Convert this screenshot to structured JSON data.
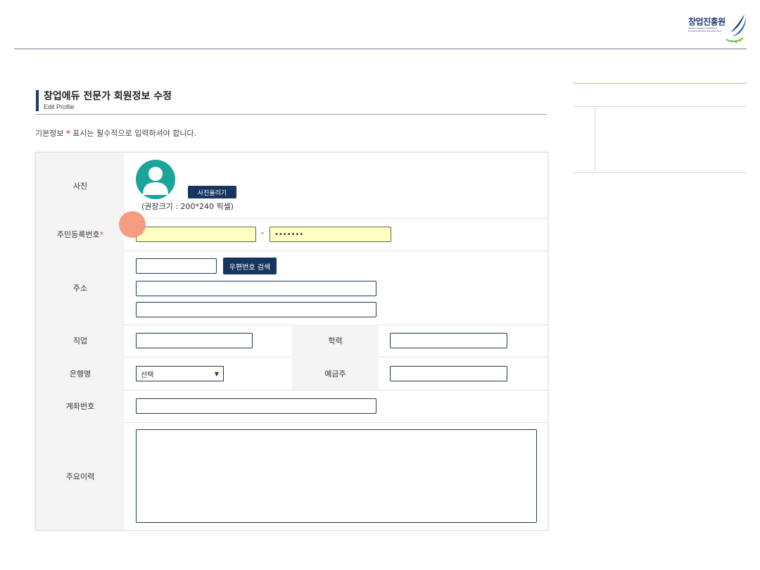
{
  "logo": {
    "name": "창업진흥원",
    "sub": "Korea Institute of Startup & Entrepreneurship Development"
  },
  "page": {
    "title": "창업에듀 전문가 회원정보 수정",
    "subtitle": "Edit Profile",
    "notice_prefix": "기본정보",
    "notice_mark": "*",
    "notice_suffix": "표시는 필수적으로 입력하셔야 합니다."
  },
  "form": {
    "photo": {
      "label": "사진",
      "upload_button": "사진올리기",
      "hint": "(권장크기 : 200*240 픽셀)"
    },
    "resident_number": {
      "label": "주민등록번호",
      "required_mark": "*",
      "front_value": "",
      "separator": "–",
      "back_value": "•••••••"
    },
    "address": {
      "label": "주소",
      "zipcode_value": "",
      "zipcode_button": "우편번호 검색",
      "line1_value": "",
      "line2_value": ""
    },
    "job": {
      "label": "직업",
      "value": ""
    },
    "education": {
      "label": "학력",
      "value": ""
    },
    "bank": {
      "label": "은행명",
      "selected": "선택"
    },
    "depositor": {
      "label": "예금주",
      "value": ""
    },
    "account": {
      "label": "계좌번호",
      "value": ""
    },
    "career": {
      "label": "주요이력",
      "value": ""
    }
  },
  "colors": {
    "navy": "#17355e",
    "required": "#e0453b",
    "highlight_input": "#ffffc4",
    "avatar": "#1ba59a"
  }
}
